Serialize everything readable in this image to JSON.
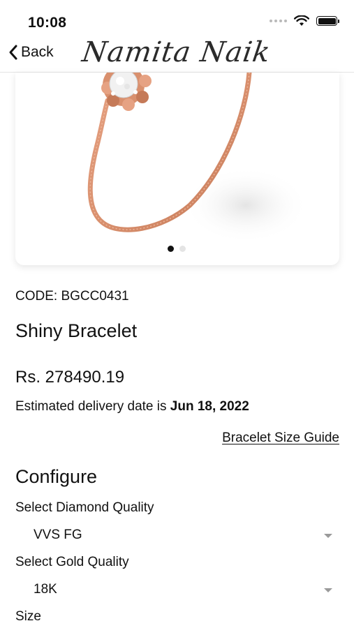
{
  "status_bar": {
    "time": "10:08"
  },
  "nav": {
    "back_label": "Back",
    "brand": "Namita Naik"
  },
  "product": {
    "code": "CODE: BGCC0431",
    "name": "Shiny Bracelet",
    "price": "Rs. 278490.19",
    "delivery_prefix": "Estimated delivery date is ",
    "delivery_date": "Jun 18, 2022",
    "size_guide_link": "Bracelet Size Guide",
    "image_pages": 2,
    "image_current_page": 1
  },
  "configure": {
    "heading": "Configure",
    "diamond_label": "Select Diamond Quality",
    "diamond_value": "VVS FG",
    "gold_label": "Select Gold Quality",
    "gold_value": "18K",
    "size_label": "Size"
  },
  "colors": {
    "rose_gold": "#d9906e",
    "pager_active": "#111111",
    "pager_inactive": "#e4e4e4"
  }
}
